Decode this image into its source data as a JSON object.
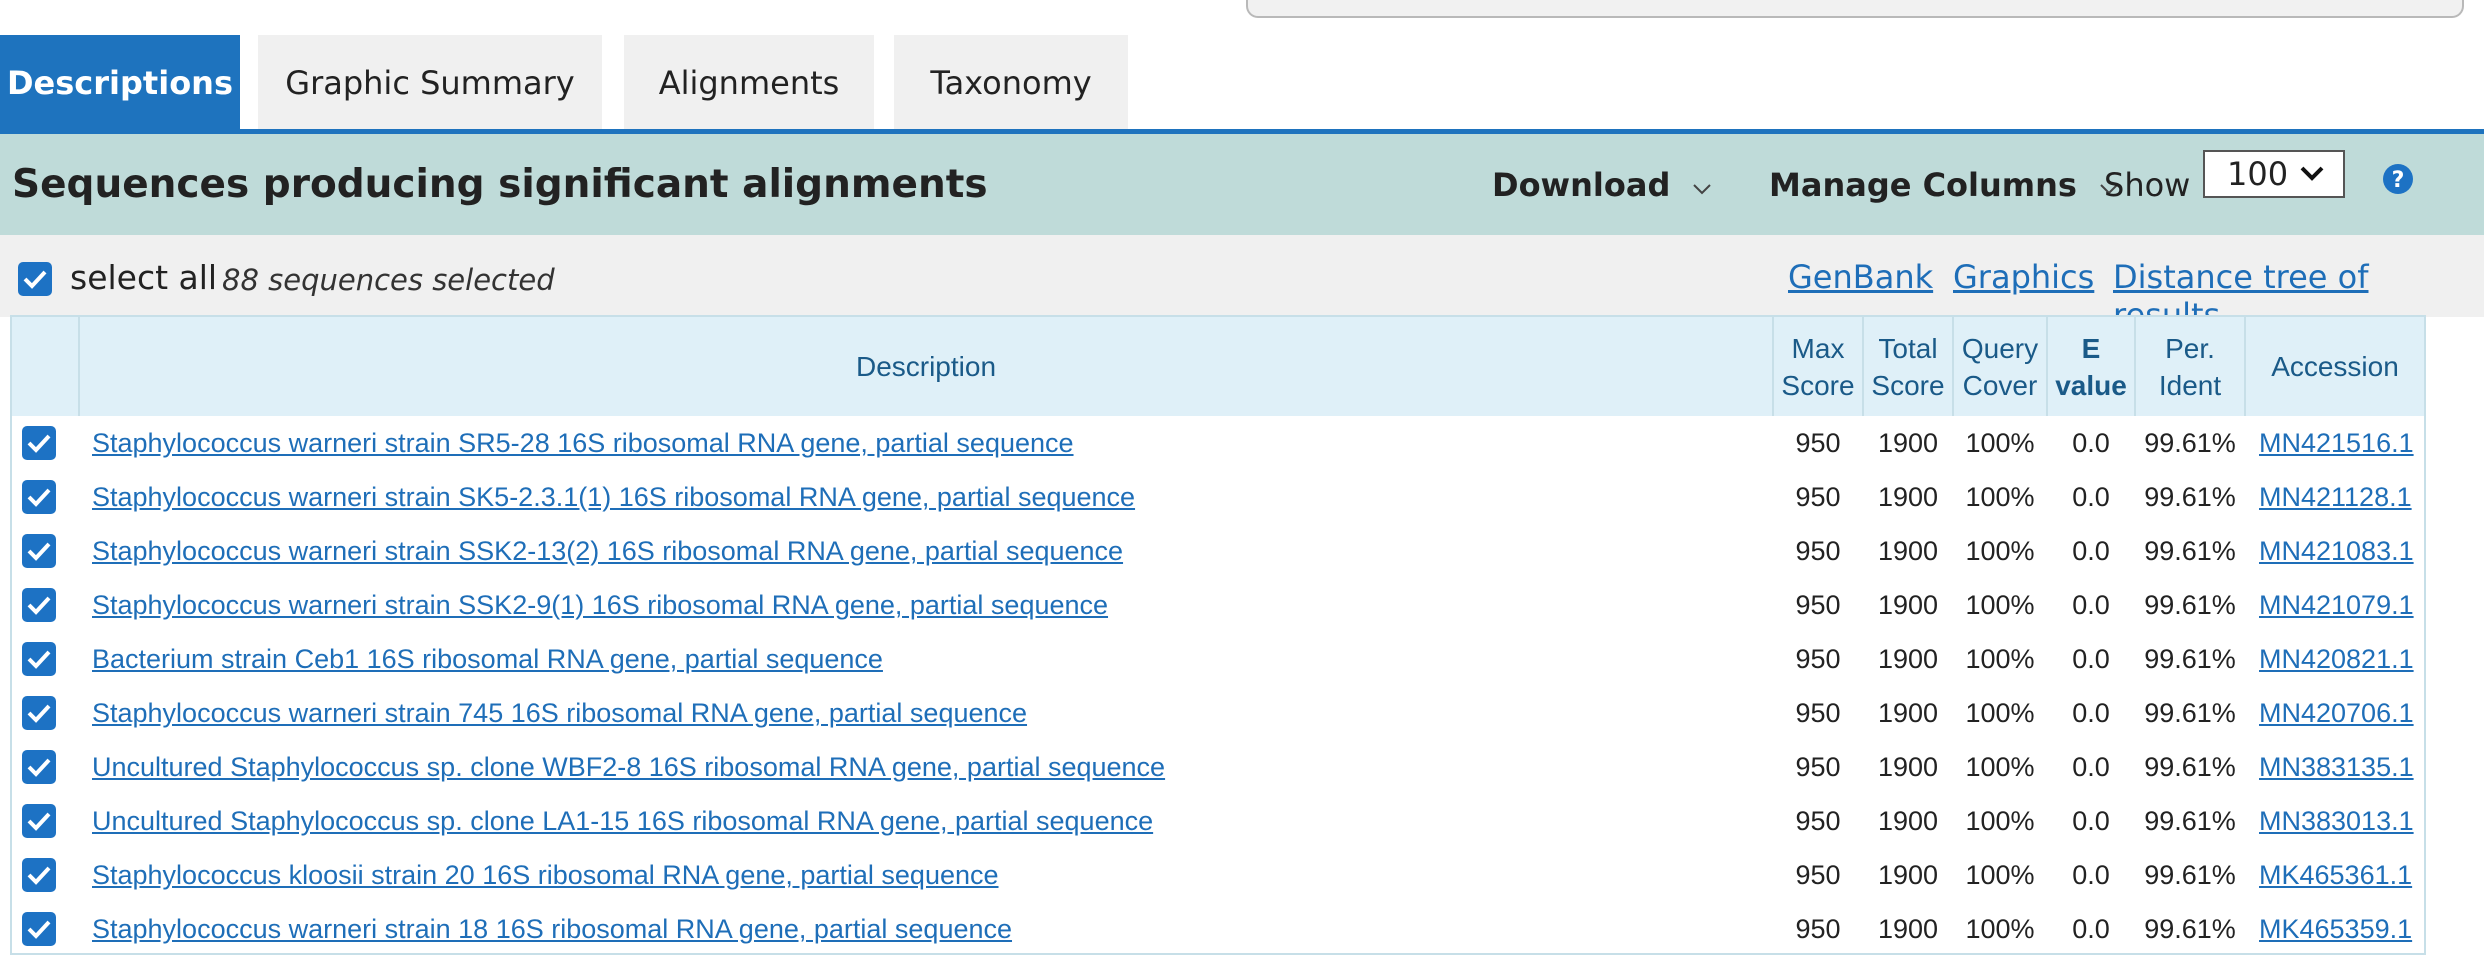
{
  "tabs": [
    {
      "label": "Descriptions",
      "active": true
    },
    {
      "label": "Graphic Summary",
      "active": false
    },
    {
      "label": "Alignments",
      "active": false
    },
    {
      "label": "Taxonomy",
      "active": false
    }
  ],
  "header": {
    "title": "Sequences producing significant alignments",
    "download_label": "Download",
    "manage_columns_label": "Manage Columns",
    "show_label": "Show",
    "show_value": "100"
  },
  "subbar": {
    "select_all_label": "select all",
    "selected_count": "88 sequences selected",
    "links": [
      "GenBank",
      "Graphics",
      "Distance tree of results"
    ]
  },
  "table": {
    "columns": {
      "description": "Description",
      "max_score": [
        "Max",
        "Score"
      ],
      "total_score": [
        "Total",
        "Score"
      ],
      "query_cover": [
        "Query",
        "Cover"
      ],
      "e_value": [
        "E",
        "value"
      ],
      "per_ident": [
        "Per.",
        "Ident"
      ],
      "accession": "Accession"
    },
    "rows": [
      {
        "desc": "Staphylococcus warneri strain SR5-28 16S ribosomal RNA gene, partial sequence",
        "max": "950",
        "total": "1900",
        "cover": "100%",
        "e": "0.0",
        "ident": "99.61%",
        "acc": "MN421516.1"
      },
      {
        "desc": "Staphylococcus warneri strain SK5-2.3.1(1) 16S ribosomal RNA gene, partial sequence",
        "max": "950",
        "total": "1900",
        "cover": "100%",
        "e": "0.0",
        "ident": "99.61%",
        "acc": "MN421128.1"
      },
      {
        "desc": "Staphylococcus warneri strain SSK2-13(2) 16S ribosomal RNA gene, partial sequence",
        "max": "950",
        "total": "1900",
        "cover": "100%",
        "e": "0.0",
        "ident": "99.61%",
        "acc": "MN421083.1"
      },
      {
        "desc": "Staphylococcus warneri strain SSK2-9(1) 16S ribosomal RNA gene, partial sequence",
        "max": "950",
        "total": "1900",
        "cover": "100%",
        "e": "0.0",
        "ident": "99.61%",
        "acc": "MN421079.1"
      },
      {
        "desc": "Bacterium strain Ceb1 16S ribosomal RNA gene, partial sequence",
        "max": "950",
        "total": "1900",
        "cover": "100%",
        "e": "0.0",
        "ident": "99.61%",
        "acc": "MN420821.1"
      },
      {
        "desc": "Staphylococcus warneri strain 745 16S ribosomal RNA gene, partial sequence",
        "max": "950",
        "total": "1900",
        "cover": "100%",
        "e": "0.0",
        "ident": "99.61%",
        "acc": "MN420706.1"
      },
      {
        "desc": "Uncultured Staphylococcus sp. clone WBF2-8 16S ribosomal RNA gene, partial sequence",
        "max": "950",
        "total": "1900",
        "cover": "100%",
        "e": "0.0",
        "ident": "99.61%",
        "acc": "MN383135.1"
      },
      {
        "desc": "Uncultured Staphylococcus sp. clone LA1-15 16S ribosomal RNA gene, partial sequence",
        "max": "950",
        "total": "1900",
        "cover": "100%",
        "e": "0.0",
        "ident": "99.61%",
        "acc": "MN383013.1"
      },
      {
        "desc": "Staphylococcus kloosii strain 20 16S ribosomal RNA gene, partial sequence",
        "max": "950",
        "total": "1900",
        "cover": "100%",
        "e": "0.0",
        "ident": "99.61%",
        "acc": "MK465361.1"
      },
      {
        "desc": "Staphylococcus warneri strain 18 16S ribosomal RNA gene, partial sequence",
        "max": "950",
        "total": "1900",
        "cover": "100%",
        "e": "0.0",
        "ident": "99.61%",
        "acc": "MK465359.1"
      }
    ]
  },
  "colors": {
    "accent": "#1e73be",
    "header_bg": "#bfdbd9",
    "link": "#1e6eb8",
    "table_head_bg": "#dff0f8"
  }
}
